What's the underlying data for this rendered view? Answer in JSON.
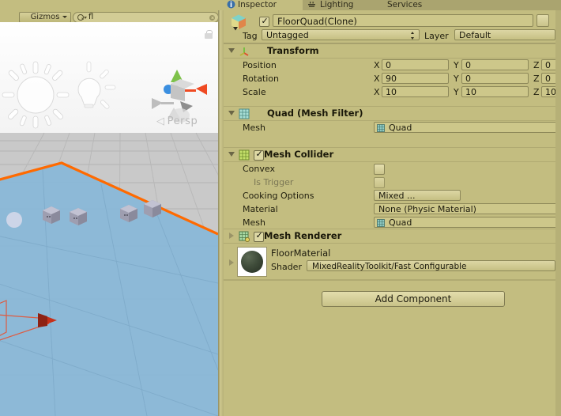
{
  "scene": {
    "menu_icon": "hamburger-menu-icon",
    "gizmos_label": "Gizmos",
    "search_value": "fl",
    "search_placeholder": "",
    "perspective_label": "Persp",
    "perspective_arrow": "◁",
    "lock_icon": "lock-icon",
    "gizmo_axes": [
      "x-axis-cone-red",
      "y-axis-cone-green",
      "z-axis-cone-blue"
    ],
    "light_gizmos": [
      "directional-light-sun-icon",
      "point-light-bulb-icon"
    ],
    "selection_outline_color": "#ff6a00",
    "floor_color": "#86b5d6",
    "grid_color": "#b0b0b0",
    "camera_gizmo_color": "#d43a1f"
  },
  "inspector": {
    "tabs": [
      {
        "label": "Inspector",
        "icon": "inspector-icon",
        "active": true
      },
      {
        "label": "Lighting",
        "icon": "lighting-icon",
        "active": false
      },
      {
        "label": "Services",
        "icon": "services-icon",
        "active": false
      }
    ],
    "object": {
      "icon": "gameobject-cube-icon",
      "enabled": true,
      "name": "FloorQuad(Clone)",
      "static_label": "",
      "tag_label": "Tag",
      "tag_value": "Untagged",
      "layer_label": "Layer",
      "layer_value": "Default"
    },
    "components": [
      {
        "title": "Transform",
        "icon": "transform-axis-icon",
        "expanded": true,
        "has_checkbox": false,
        "rows": [
          {
            "label": "Position",
            "axes": [
              "X",
              "Y",
              "Z"
            ],
            "values": [
              "0",
              "0",
              "0"
            ]
          },
          {
            "label": "Rotation",
            "axes": [
              "X",
              "Y",
              "Z"
            ],
            "values": [
              "90",
              "0",
              "0"
            ]
          },
          {
            "label": "Scale",
            "axes": [
              "X",
              "Y",
              "Z"
            ],
            "values": [
              "10",
              "10",
              "10"
            ]
          }
        ]
      },
      {
        "title": "Quad (Mesh Filter)",
        "icon": "mesh-filter-icon",
        "expanded": true,
        "has_checkbox": false,
        "mesh_label": "Mesh",
        "mesh_value": "Quad"
      },
      {
        "title": "Mesh Collider",
        "icon": "mesh-collider-icon",
        "expanded": true,
        "has_checkbox": true,
        "checked": true,
        "convex_label": "Convex",
        "convex_checked": false,
        "is_trigger_label": "Is Trigger",
        "is_trigger_checked": false,
        "cooking_label": "Cooking Options",
        "cooking_value": "Mixed ...",
        "material_label": "Material",
        "material_value": "None (Physic Material)",
        "mesh_label": "Mesh",
        "mesh_value": "Quad"
      },
      {
        "title": "Mesh Renderer",
        "icon": "mesh-renderer-icon",
        "expanded": false,
        "has_checkbox": true,
        "checked": true
      }
    ],
    "material": {
      "preview_icon": "material-sphere-preview",
      "name": "FloorMaterial",
      "shader_label": "Shader",
      "shader_value": "MixedRealityToolkit/Fast Configurable"
    },
    "add_component_label": "Add Component"
  }
}
